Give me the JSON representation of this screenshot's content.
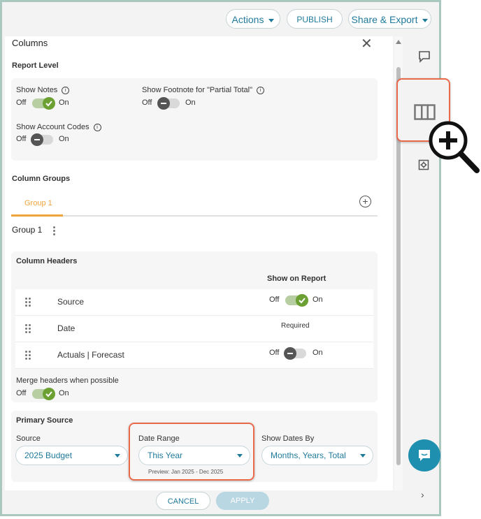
{
  "toolbar": {
    "actions_label": "Actions",
    "publish_label": "PUBLISH",
    "share_label": "Share & Export"
  },
  "panel": {
    "title": "Columns"
  },
  "report_level": {
    "heading": "Report Level",
    "show_notes": {
      "label": "Show Notes",
      "off": "Off",
      "on": "On",
      "state": "on"
    },
    "show_footnote": {
      "label": "Show Footnote for \"Partial Total\"",
      "off": "Off",
      "on": "On",
      "state": "off"
    },
    "show_account_codes": {
      "label": "Show Account Codes",
      "off": "Off",
      "on": "On",
      "state": "off"
    }
  },
  "column_groups": {
    "heading": "Column Groups",
    "tabs": [
      {
        "label": "Group 1"
      }
    ],
    "group_title": "Group 1"
  },
  "column_headers": {
    "heading": "Column Headers",
    "show_on_report": "Show on Report",
    "rows": [
      {
        "label": "Source",
        "off": "Off",
        "on": "On",
        "state": "on"
      },
      {
        "label": "Date",
        "status": "Required"
      },
      {
        "label": "Actuals | Forecast",
        "off": "Off",
        "on": "On",
        "state": "off"
      }
    ],
    "merge": {
      "label": "Merge headers when possible",
      "off": "Off",
      "on": "On",
      "state": "on"
    }
  },
  "primary_source": {
    "heading": "Primary Source",
    "source": {
      "label": "Source",
      "value": "2025 Budget"
    },
    "date_range": {
      "label": "Date Range",
      "value": "This Year",
      "preview": "Preview: Jan 2025 - Dec 2025"
    },
    "show_dates_by": {
      "label": "Show Dates By",
      "value": "Months, Years, Total"
    }
  },
  "footer": {
    "cancel_label": "CANCEL",
    "apply_label": "APPLY"
  },
  "colors": {
    "accent": "#1f7a99",
    "tab_active": "#f0a43c",
    "toggle_on": "#6ca033",
    "highlight": "#e86a4a"
  },
  "icons": [
    "close-icon",
    "info-icon",
    "add-circle-icon",
    "kebab-menu-icon",
    "drag-handle-icon",
    "comment-icon",
    "columns-icon",
    "settings-icon",
    "chevron-right-icon",
    "chat-icon",
    "zoom-in-icon"
  ]
}
